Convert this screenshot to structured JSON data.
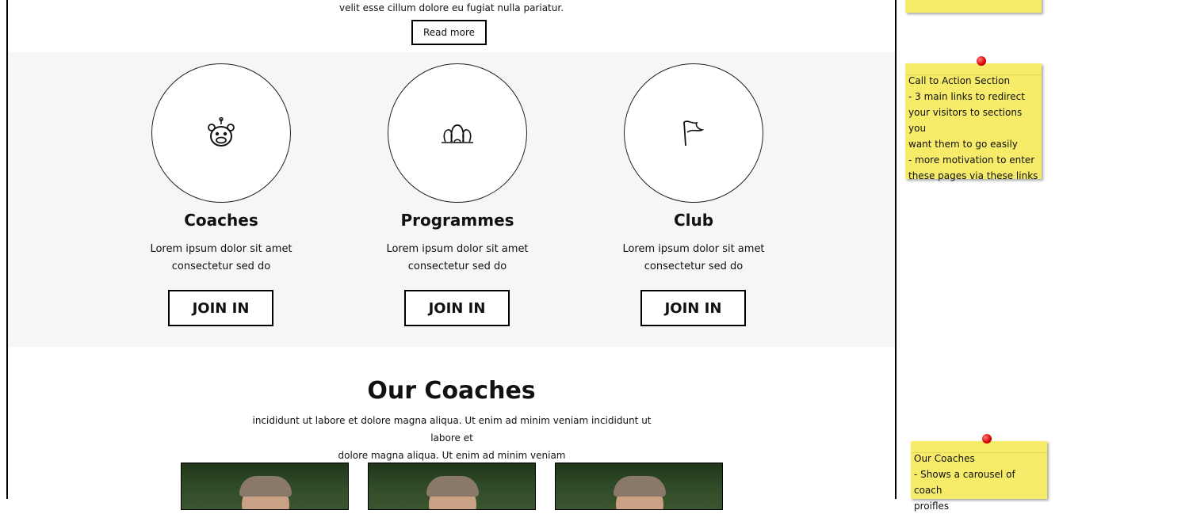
{
  "intro": {
    "text": "velit esse cillum dolore eu fugiat nulla pariatur.",
    "read_more": "Read more"
  },
  "cta": {
    "cards": [
      {
        "title": "Coaches",
        "line1": "Lorem ipsum dolor sit amet",
        "line2": "consectetur sed do",
        "button": "JOIN IN",
        "icon": "bear-face-icon"
      },
      {
        "title": "Programmes",
        "line1": "Lorem ipsum dolor sit amet",
        "line2": "consectetur sed do",
        "button": "JOIN IN",
        "icon": "group-icon"
      },
      {
        "title": "Club",
        "line1": "Lorem ipsum dolor sit amet",
        "line2": "consectetur sed do",
        "button": "JOIN IN",
        "icon": "flag-icon"
      }
    ]
  },
  "coaches": {
    "title": "Our Coaches",
    "line1": "incididunt ut labore et dolore magna aliqua. Ut enim ad minim veniam incididunt ut labore et",
    "line2": "dolore magna aliqua. Ut enim ad minim veniam"
  },
  "notes": {
    "cta_note": {
      "line1": "Call to Action Section",
      "line2": "- 3 main links to redirect",
      "line3": "your visitors to sections you",
      "line4": "want them to go easily",
      "line5": "- more motivation to enter",
      "line6": "these pages via these links"
    },
    "coaches_note": {
      "line1": "Our Coaches",
      "line2": "- Shows a carousel of coach",
      "line3": "proifles"
    }
  },
  "colors": {
    "note_yellow": "#f7ec6a",
    "section_gray": "#f6f6f6",
    "pin_red": "#d80000"
  }
}
